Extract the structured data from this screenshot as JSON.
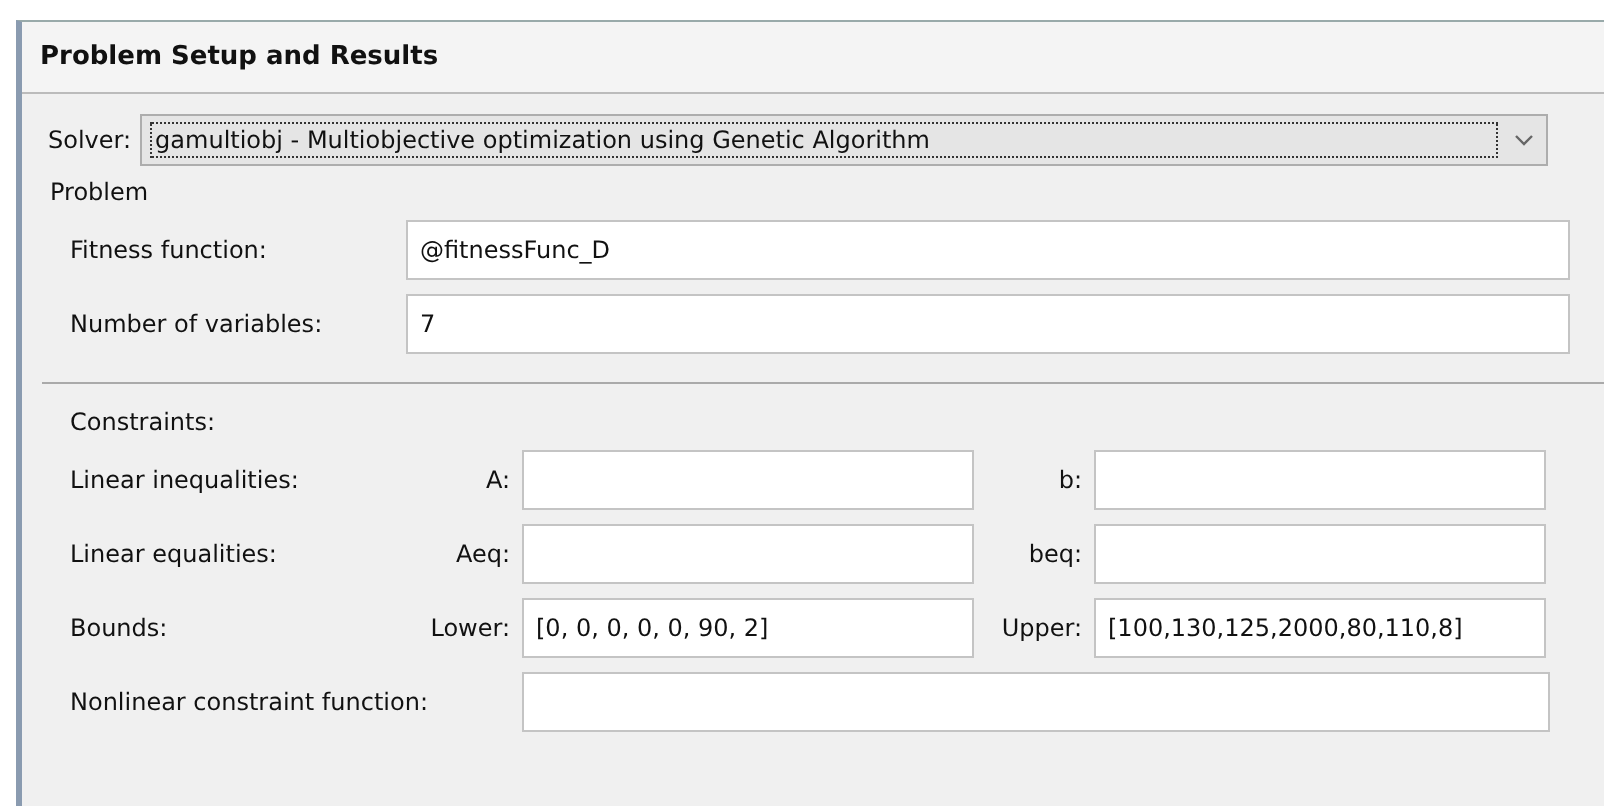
{
  "panel": {
    "title": "Problem Setup and Results"
  },
  "solver": {
    "label": "Solver:",
    "value": "gamultiobj - Multiobjective optimization using Genetic Algorithm"
  },
  "problem": {
    "title": "Problem",
    "fields": [
      {
        "label": "Fitness function:",
        "value": "@fitnessFunc_D"
      },
      {
        "label": "Number of variables:",
        "value": "7"
      }
    ]
  },
  "constraints": {
    "title": "Constraints:",
    "rows": [
      {
        "label": "Linear inequalities:",
        "kind": "pair",
        "left_label": "A:",
        "left_value": "",
        "right_label": "b:",
        "right_value": ""
      },
      {
        "label": "Linear equalities:",
        "kind": "pair",
        "left_label": "Aeq:",
        "left_value": "",
        "right_label": "beq:",
        "right_value": ""
      },
      {
        "label": "Bounds:",
        "kind": "pair",
        "left_label": "Lower:",
        "left_value": "[0, 0, 0, 0, 0, 90, 2]",
        "right_label": "Upper:",
        "right_value": "[100,130,125,2000,80,110,8]"
      },
      {
        "label": "Nonlinear constraint function:",
        "kind": "single",
        "value": ""
      }
    ]
  }
}
